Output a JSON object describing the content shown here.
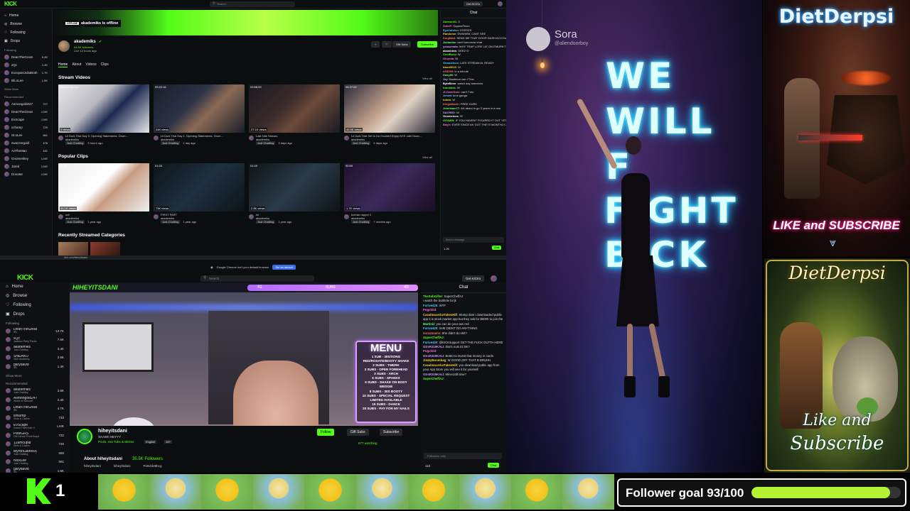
{
  "top_kick": {
    "logo": "KICK",
    "search_placeholder": "Search",
    "header_right_btn": "Get KICKs",
    "sidebar": {
      "nav": [
        "Home",
        "Browse",
        "Following",
        "Drops"
      ],
      "following_label": "Following",
      "following": [
        {
          "name": "DeanTheGreat",
          "count": "5.2K"
        },
        {
          "name": "xQc",
          "count": "1.4K"
        },
        {
          "name": "EuropaisJuliaBrah",
          "count": "1.7K"
        },
        {
          "name": "Bb.oLee",
          "count": "1.5K"
        }
      ],
      "show_more": "Show More",
      "recommended_label": "Recommended",
      "recommended": [
        {
          "name": "Asmongold247",
          "count": "727"
        },
        {
          "name": "DeanTheGreat",
          "count": "LIVE"
        },
        {
          "name": "EvScape",
          "count": "LIVE"
        },
        {
          "name": "xchamp",
          "count": "729"
        },
        {
          "name": "St.oLee",
          "count": "581"
        },
        {
          "name": "swazzergold",
          "count": "476"
        },
        {
          "name": "AzTheMan",
          "count": "181"
        },
        {
          "name": "Gnomeskey",
          "count": "LIVE"
        },
        {
          "name": "Jared",
          "count": "LIVE"
        },
        {
          "name": "Donatar",
          "count": "LIVE"
        }
      ]
    },
    "banner": {
      "badge": "OFFLINE",
      "text": "akademiks is offline"
    },
    "channel": {
      "name": "akademiks",
      "followers": "94.6K followers",
      "last_live": "Live 12 hours ago",
      "btn_gift": "Gift Subs",
      "btn_subscribe": "Subscribe"
    },
    "tabs": [
      "Home",
      "About",
      "Videos",
      "Clips"
    ],
    "stream_videos": {
      "title": "Stream Videos",
      "view_all": "View all",
      "items": [
        {
          "duration": "Current Stream",
          "views": "0 views",
          "title": "Lil Durk Trial Day 5. Opening Statements, Drom...",
          "author": "akademiks",
          "cat": "Just Chatting",
          "time": "5 hours ago"
        },
        {
          "duration": "05:22:16",
          "views": "24K views",
          "title": "Lil Durk Trial Day 1. Opening Statements. Drom...",
          "author": "akademiks",
          "cat": "Just Chatting",
          "time": "1 day ago"
        },
        {
          "duration": "03:58:33",
          "views": "27.1K views",
          "title": "Late Nite Stream.",
          "author": "akademiks",
          "cat": "Just Chatting",
          "time": "3 days ago"
        },
        {
          "duration": "06:37:02",
          "views": "45.5K views",
          "title": "Lil Durk Trial Set to Go Couldn't Enjoy NYE until Guan...",
          "author": "akademiks",
          "cat": "Just Chatting",
          "time": "4 days ago"
        }
      ]
    },
    "popular_clips": {
      "title": "Popular Clips",
      "view_all": "View all",
      "items": [
        {
          "duration": "01:00",
          "views": "41.1K views",
          "title": "oof",
          "author": "akademiks",
          "cat": "Just Chatting",
          "time": "1 year ago"
        },
        {
          "duration": "01:00",
          "views": "73K views",
          "title": "FIRST PART",
          "author": "akademiks",
          "cat": "Just Chatting",
          "time": "1 year ago"
        },
        {
          "duration": "01:00",
          "views": "2.5K views",
          "title": "lol",
          "author": "akademiks",
          "cat": "Just Chatting",
          "time": "1 year ago"
        },
        {
          "duration": "00:59",
          "views": "1.7K views",
          "title": "korean rapper 2",
          "author": "akademiks",
          "cat": "Just Chatting",
          "time": "7 months ago"
        }
      ]
    },
    "recent_categories": "Recently Streamed Categories",
    "chat": {
      "title": "Chat",
      "lines": [
        {
          "user": "Aimsun01",
          "text": "S",
          "color": "#53fc18"
        },
        {
          "user": "SokeF",
          "text": "SoyaxeFelon",
          "color": "#f6c"
        },
        {
          "user": "EyeCatcher",
          "text": "ESSSSS",
          "color": "#5cf"
        },
        {
          "user": "Randome",
          "text": "EWWWW, CANT SEE",
          "color": "#fc3"
        },
        {
          "user": "KingMatt",
          "text": "SEND ME THAT DOOR DASH ACCOUNT",
          "color": "#f66"
        },
        {
          "user": "Javianiac",
          "text": "can't tomorrow chat",
          "color": "#6f6"
        },
        {
          "user": "yeasumata",
          "text": "WHY TRAP LORE LIE ON EMURK???",
          "color": "#c9f"
        },
        {
          "user": "akamidew",
          "text": "DEEZ G",
          "color": "#fff"
        },
        {
          "user": "CoolBoss",
          "text": "W",
          "color": "#53fc18"
        },
        {
          "user": "Ghonda",
          "text": "W",
          "color": "#f6c"
        },
        {
          "user": "Gnomeicus",
          "text": "LATE STREAM AL READY",
          "color": "#5cf"
        },
        {
          "user": "blaze9616",
          "text": "W",
          "color": "#fc3"
        },
        {
          "user": "sSS005",
          "text": "in a minute",
          "color": "#f66"
        },
        {
          "user": "Dasy85",
          "text": "W",
          "color": "#6f6"
        },
        {
          "user": "Jay",
          "text": "Baubbuu can I Tmo",
          "color": "#c9f"
        },
        {
          "user": "ByteBeve",
          "text": "watch day tomorrow",
          "color": "#fff"
        },
        {
          "user": "tunnakos",
          "text": "W",
          "color": "#53fc18"
        },
        {
          "user": "JLOwerDoer",
          "text": "can't Tmo",
          "color": "#f6c"
        },
        {
          "user": "JeroId",
          "text": "time ganga",
          "color": "#5cf"
        },
        {
          "user": "bdoto",
          "text": "W",
          "color": "#fc3"
        },
        {
          "user": "KingsMacth",
          "text": "FREE DURK",
          "color": "#f66"
        },
        {
          "user": "JeterIsam77",
          "text": "AK about to go 2 years in a row",
          "color": "#6f6"
        },
        {
          "user": "SACRED",
          "text": "W",
          "color": "#c9f"
        },
        {
          "user": "Gnomeicus",
          "text": "W",
          "color": "#fff"
        },
        {
          "user": "UOAWN",
          "text": "IF YOU HAVENT FIGURED IT OUT YET",
          "color": "#53fc18"
        },
        {
          "user": "Bayle",
          "text": "EVER SINCE AK GOT THE IS MONTHLY ALLOWANCE",
          "color": "#f6c"
        }
      ],
      "input_placeholder": "Send a message",
      "count": "1.2K",
      "chat_btn": "Chat"
    }
  },
  "bottom_kick": {
    "url": "kick.com/hiheyitsdani",
    "notice": "Google Chrome isn't your default browser",
    "notice_btn": "Set as default",
    "logo": "KICK",
    "search_placeholder": "Search",
    "header_right_btn": "Get KICKs",
    "sidebar": {
      "nav": [
        "Home",
        "Browse",
        "Following",
        "Drops"
      ],
      "following_label": "Following",
      "following": [
        {
          "name": "DeanTheGreat",
          "sub": "IRL",
          "count": "12.7K"
        },
        {
          "name": "xQc",
          "sub": "Jackbox Party Packs",
          "count": "7.6K"
        },
        {
          "name": "akademiks",
          "sub": "Just Chatting",
          "count": "3.4K"
        },
        {
          "name": "SNEAKO",
          "sub": "Club Academy",
          "count": "2.6K"
        },
        {
          "name": "garydavid",
          "sub": "IRL",
          "count": "1.4K"
        }
      ],
      "show_more": "Show More",
      "recommended_label": "Recommended",
      "recommended": [
        {
          "name": "akademiks",
          "sub": "Just Chatting",
          "count": "3.6K"
        },
        {
          "name": "Asmongold247",
          "sub": "World of Warcraft",
          "count": "2.4K"
        },
        {
          "name": "DeanTheGreat",
          "sub": "IRL",
          "count": "4.7K"
        },
        {
          "name": "ishlump",
          "sub": "Slots & Casino",
          "count": "733"
        },
        {
          "name": "EvScape",
          "sub": "Grand Theft Auto V",
          "count": "LIVE"
        },
        {
          "name": "PeteGRS",
          "sub": "Old School RuneScape",
          "count": "722"
        },
        {
          "name": "12amcupid",
          "sub": "Slots & Casino",
          "count": "720"
        },
        {
          "name": "MyronGainesX",
          "sub": "Just Chatting",
          "count": "665"
        },
        {
          "name": "NickLee",
          "sub": "Just Chatting",
          "count": "591"
        },
        {
          "name": "garydavid",
          "sub": "IRL",
          "count": "1.6K"
        }
      ]
    },
    "video": {
      "overlay_name": "HIHEYITSDANI",
      "sub_goal_left": "41",
      "sub_goal_label": "SUBS",
      "sub_goal_right": "40",
      "menu_title": "MENU",
      "menu_items": [
        "1 SUB - 30S/SONG",
        "RED/ROSATE/BOOTY SHAKE",
        "2 SUBS - TWERK",
        "3 SUBS - OPEN FOREHEAD",
        "3 SUBS - ARCH",
        "5 SUBS - SPANKS",
        "5 SUBS - SHAKE ON BODY",
        "WEDGIE",
        "8 SUBS - 30S BOOTY",
        "10 SUBS - SPECIAL REQUEST",
        "LIMITED AVAILABLE",
        "15 SUBS - DANCE",
        "20 SUBS - PAY FOR MY NAILS"
      ]
    },
    "channel": {
      "name": "hiheyitsdani",
      "viewers": "SAAWII HEYYY",
      "tags": [
        "Pools, Hot Tubs & Bikinis",
        "English",
        "18+"
      ],
      "follow_btn": "Follow",
      "gift_btn": "Gift Subs",
      "subscribe_btn": "Subscribe",
      "watching": "877 watching",
      "about_title": "About hiheyitsdani",
      "about_followers": "35.5K Followers",
      "socials": [
        "hiheyitsdani",
        "hiheyitsdani",
        "PoN4349bcg"
      ]
    },
    "chat": {
      "title": "Chat",
      "lines": [
        {
          "user": "TheSubGifter",
          "text": "SuperCheffAJ",
          "color": "#53fc18"
        },
        {
          "user": "",
          "text": "i watch the butthole lol jk",
          "color": "#fff"
        },
        {
          "user": "Fxrrve420",
          "text": "WTF",
          "color": "#5cf"
        },
        {
          "user": "Pogchild",
          "text": "",
          "color": "#f6c"
        },
        {
          "user": "CasalmacerlarTakesHill",
          "text": "Stump dani i downloaded public app it is stock market app but they ask for $5000 to join the market",
          "color": "#fc3"
        },
        {
          "user": "Martiniz",
          "text": "you can do your ass red",
          "color": "#6f6"
        },
        {
          "user": "Fxrrve420",
          "text": "SHE DIDNT DO ANYTHING",
          "color": "#5cf"
        },
        {
          "user": "tossotoams",
          "text": "She didn't do shit?",
          "color": "#f66"
        },
        {
          "user": "SuperCheffAJ",
          "text": "",
          "color": "#53fc18"
        },
        {
          "user": "Fxrrve420",
          "text": "@KICKsupport GET THE FUCK OUTTA HERE",
          "color": "#5cf"
        },
        {
          "user": "GtrsR319KALI",
          "text": "that's nuts lol SK?",
          "color": "#c9f"
        },
        {
          "user": "Pogchild",
          "text": "",
          "color": "#f6c"
        },
        {
          "user": "GtrsR319KALI",
          "text": "Better to invest that money in cards",
          "color": "#c9f"
        },
        {
          "user": "JimbyBoombag",
          "text": "W GOOD OFF THAT B BRUHH",
          "color": "#fc3"
        },
        {
          "user": "CasalmacerlarTakesHill",
          "text": "you download public app from your App Store you will see it for yourself",
          "color": "#fc3"
        },
        {
          "user": "GtrsR319KALI",
          "text": "Minecraft time?",
          "color": "#c9f"
        },
        {
          "user": "SuperCheffAJ",
          "text": "",
          "color": "#53fc18"
        }
      ],
      "input_placeholder": "Followers only",
      "count": "110",
      "chat_btn": "Chat"
    }
  },
  "webcam": {
    "logo_name": "Sora",
    "logo_handle": "@aliendoorboy",
    "neon_lines": [
      "WE",
      "WILL",
      "F",
      "F  GHT",
      "B  CK"
    ]
  },
  "art_top": {
    "title": "DietDerpsi",
    "cta": "LIKE and SUBSCRIBE"
  },
  "art_bottom": {
    "title": "DietDerpsi",
    "cta_line1": "Like and",
    "cta_line2": "Subscribe"
  },
  "bottom_strip": {
    "kick_count": "1",
    "follower_goal_label": "Follower goal 93/100",
    "follower_goal_fraction": 0.93,
    "colors": {
      "goal_fill": "#b4f234",
      "kick_green": "#53fc18"
    }
  }
}
